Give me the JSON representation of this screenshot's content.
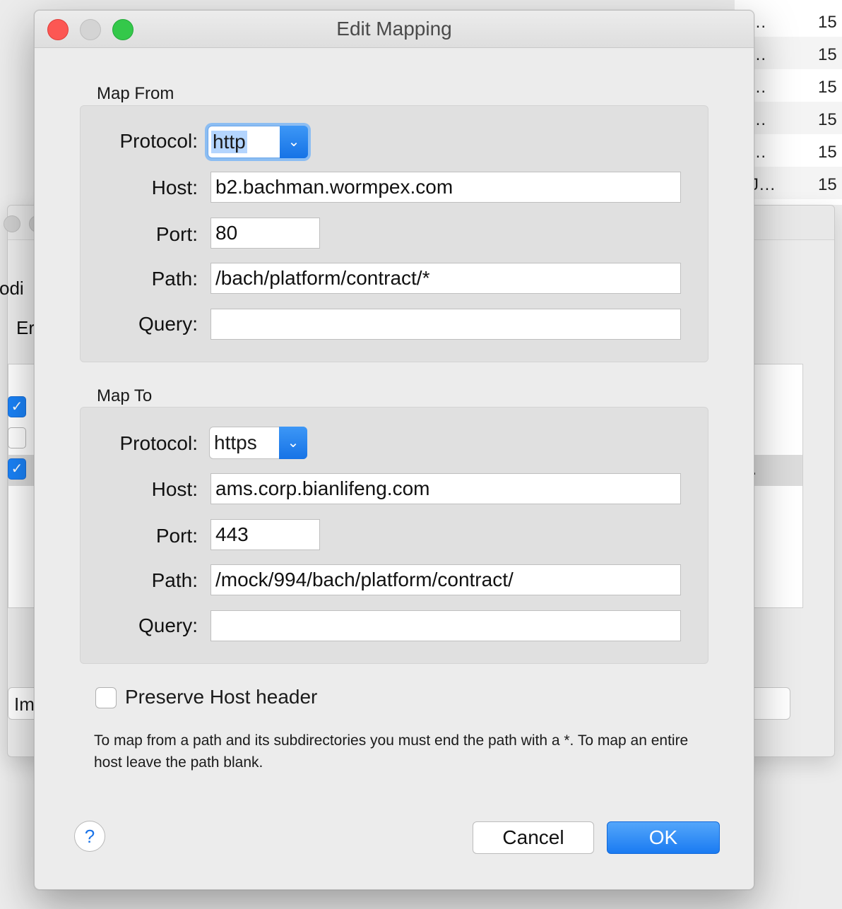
{
  "background": {
    "list_rows": [
      {
        "ellipsis": "...",
        "num": "15"
      },
      {
        "ellipsis": "...",
        "num": "15"
      },
      {
        "ellipsis": "...",
        "num": "15"
      },
      {
        "ellipsis": "...",
        "num": "15"
      },
      {
        "ellipsis": "...",
        "num": "15"
      },
      {
        "ellipsis": "J...",
        "num": "15"
      }
    ],
    "window_texts": {
      "partial_odi": "odi",
      "partial_en": "Er",
      "partial_im": "Im",
      "row_dot": "."
    }
  },
  "dialog": {
    "title": "Edit Mapping",
    "map_from": {
      "section_label": "Map From",
      "protocol_label": "Protocol:",
      "protocol_value": "http",
      "host_label": "Host:",
      "host_value": "b2.bachman.wormpex.com",
      "port_label": "Port:",
      "port_value": "80",
      "path_label": "Path:",
      "path_value": "/bach/platform/contract/*",
      "query_label": "Query:",
      "query_value": ""
    },
    "map_to": {
      "section_label": "Map To",
      "protocol_label": "Protocol:",
      "protocol_value": "https",
      "host_label": "Host:",
      "host_value": "ams.corp.bianlifeng.com",
      "port_label": "Port:",
      "port_value": "443",
      "path_label": "Path:",
      "path_value": "/mock/994/bach/platform/contract/",
      "query_label": "Query:",
      "query_value": ""
    },
    "preserve_host_label": "Preserve Host header",
    "preserve_host_checked": false,
    "hint": "To map from a path and its subdirectories you must end the path with a *. To map an entire host leave the path blank.",
    "help_label": "?",
    "cancel_label": "Cancel",
    "ok_label": "OK",
    "chevron_glyph": "⌄"
  }
}
